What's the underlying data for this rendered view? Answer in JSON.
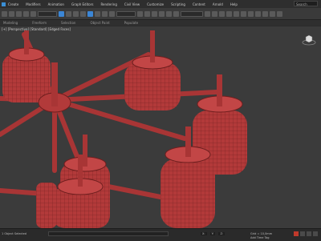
{
  "menubar": {
    "items": [
      "Create",
      "Modifiers",
      "Animation",
      "Graph Editors",
      "Rendering",
      "Civil View",
      "Customize",
      "Scripting",
      "Content",
      "Arnold",
      "Help"
    ],
    "search_placeholder": "Search"
  },
  "ribbon": {
    "items": [
      "Modeling",
      "Freeform",
      "Selection",
      "Object Paint",
      "Populate"
    ]
  },
  "viewport": {
    "label": "[+] [Perspective] [Standard] [Edged Faces]",
    "background": "#3b3b3b",
    "object_color": "#b23a3a"
  },
  "statusbar": {
    "left_text": "1 Object Selected",
    "coords": [
      "X: ",
      "Y: ",
      "Z: "
    ],
    "grid_text": "Grid = 10,0mm",
    "add_time_tag": "Add Time Tag"
  }
}
